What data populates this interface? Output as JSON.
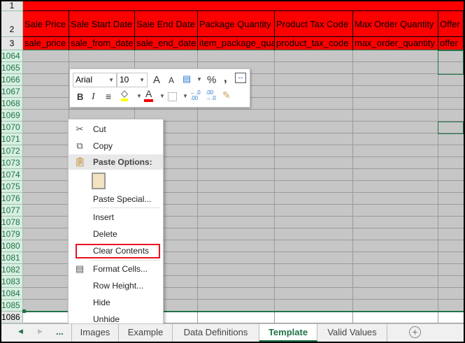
{
  "rows": {
    "header_rows": [
      "1",
      "2",
      "3"
    ],
    "data_rows": [
      "1064",
      "1065",
      "1066",
      "1067",
      "1068",
      "1069",
      "1070",
      "1071",
      "1072",
      "1073",
      "1074",
      "1075",
      "1076",
      "1077",
      "1078",
      "1079",
      "1080",
      "1081",
      "1082",
      "1083",
      "1084",
      "1085",
      "1086"
    ]
  },
  "columns": [
    {
      "label": "Sale Price",
      "field": "sale_price"
    },
    {
      "label": "Sale Start Date",
      "field": "sale_from_date"
    },
    {
      "label": "Sale End Date",
      "field": "sale_end_date"
    },
    {
      "label": "Package Quantity",
      "field": "item_package_quantity"
    },
    {
      "label": "Product Tax Code",
      "field": "product_tax_code"
    },
    {
      "label": "Max Order Quantity",
      "field": "max_order_quantity"
    },
    {
      "label": "Offer",
      "field": "offer"
    }
  ],
  "mini_toolbar": {
    "font": "Arial",
    "size": "10",
    "bold": "B",
    "italic": "I",
    "percent": "%",
    "comma": ",",
    "grow": "A",
    "shrink": "A",
    "font_color": "A",
    "inc_decimal": "←.0\n.00",
    "dec_decimal": ".00\n→.0"
  },
  "context_menu": {
    "cut": "Cut",
    "copy": "Copy",
    "paste_options": "Paste Options:",
    "paste_special": "Paste Special...",
    "insert": "Insert",
    "delete": "Delete",
    "clear_contents": "Clear Contents",
    "format_cells": "Format Cells...",
    "row_height": "Row Height...",
    "hide": "Hide",
    "unhide": "Unhide"
  },
  "sheet_tabs": {
    "more": "...",
    "tabs": [
      "Images",
      "Example",
      "Data Definitions",
      "Template",
      "Valid Values"
    ],
    "active": "Template",
    "add": "+"
  },
  "colors": {
    "header": "#ff0000",
    "selected": "#c6c6c6",
    "accent": "#217346",
    "highlight_box": "#e81123"
  }
}
